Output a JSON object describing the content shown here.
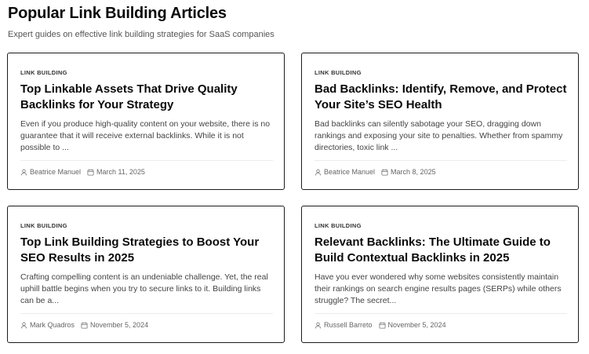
{
  "heading": "Popular Link Building Articles",
  "subheading": "Expert guides on effective link building strategies for SaaS companies",
  "articles": [
    {
      "category": "LINK BUILDING",
      "title": "Top Linkable Assets That Drive Quality Backlinks for Your Strategy",
      "excerpt": "Even if you produce high-quality content on your website, there is no guarantee that it will receive external backlinks.  While it is not possible to ...",
      "author": "Beatrice Manuel",
      "date": "March 11, 2025"
    },
    {
      "category": "LINK BUILDING",
      "title": "Bad Backlinks: Identify, Remove, and Protect Your Site’s SEO Health",
      "excerpt": "Bad backlinks can silently sabotage your SEO, dragging down rankings and exposing your site to penalties. Whether from spammy directories, toxic link ...",
      "author": "Beatrice Manuel",
      "date": "March 8, 2025"
    },
    {
      "category": "LINK BUILDING",
      "title": "Top Link Building Strategies to Boost Your SEO Results in 2025",
      "excerpt": "Crafting compelling content is an undeniable challenge. Yet, the real uphill battle begins when you try to secure links to it. Building links can be a...",
      "author": "Mark Quadros",
      "date": "November 5, 2024"
    },
    {
      "category": "LINK BUILDING",
      "title": "Relevant Backlinks: The Ultimate Guide to Build Contextual Backlinks in 2025",
      "excerpt": "Have you ever wondered why some websites consistently maintain their rankings on search engine results pages (SERPs) while others struggle? The secret...",
      "author": "Russell Barreto",
      "date": "November 5, 2024"
    }
  ]
}
